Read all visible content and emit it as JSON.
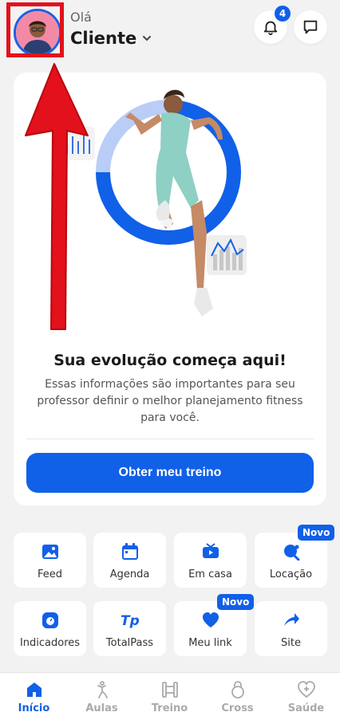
{
  "header": {
    "greeting": "Olá",
    "user_name": "Cliente",
    "notification_count": "4"
  },
  "hero": {
    "title": "Sua evolução começa aqui!",
    "description": "Essas informações são importantes para seu professor definir o melhor planejamento fitness para você.",
    "cta_label": "Obter meu treino"
  },
  "grid": {
    "items": [
      {
        "label": "Feed",
        "icon": "image-icon"
      },
      {
        "label": "Agenda",
        "icon": "calendar-icon"
      },
      {
        "label": "Em casa",
        "icon": "tv-icon"
      },
      {
        "label": "Locação",
        "icon": "ping-pong-icon",
        "badge": "Novo"
      },
      {
        "label": "Indicadores",
        "icon": "scale-icon"
      },
      {
        "label": "TotalPass",
        "icon": "totalpass-icon"
      },
      {
        "label": "Meu link",
        "icon": "heart-icon",
        "badge": "Novo"
      },
      {
        "label": "Site",
        "icon": "share-icon"
      }
    ]
  },
  "bottom_nav": {
    "items": [
      {
        "label": "Início",
        "icon": "home-icon",
        "active": true
      },
      {
        "label": "Aulas",
        "icon": "dance-icon"
      },
      {
        "label": "Treino",
        "icon": "dumbbell-icon"
      },
      {
        "label": "Cross",
        "icon": "kettlebell-icon"
      },
      {
        "label": "Saúde",
        "icon": "health-heart-icon"
      }
    ]
  },
  "colors": {
    "primary": "#1160e8",
    "highlight": "#e2111b",
    "background": "#f2f2f2"
  }
}
